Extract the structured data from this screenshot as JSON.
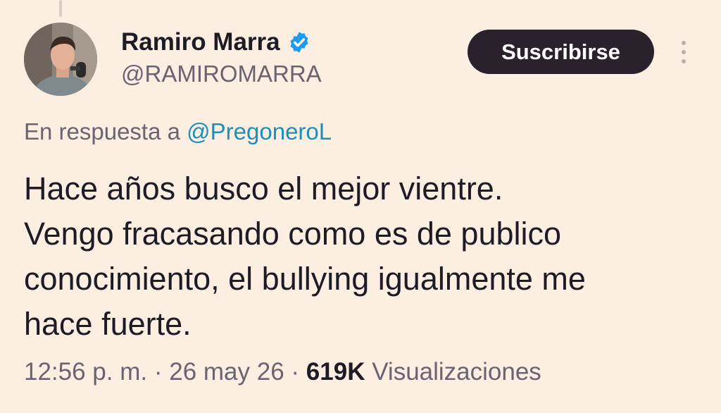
{
  "tweet": {
    "author": {
      "display_name": "Ramiro Marra",
      "handle": "@RAMIROMARRA",
      "verified": true,
      "verified_icon": "verified-badge-icon"
    },
    "subscribe_label": "Suscribirse",
    "more_icon": "more-vertical-icon",
    "reply_prefix": "En respuesta a",
    "reply_to": "@PregoneroL",
    "text_lines": [
      "Hace años busco el mejor vientre.",
      "Vengo fracasando como es de publico",
      "conocimiento, el bullying igualmente me",
      "hace fuerte."
    ],
    "time": "12:56 p. m.",
    "separator": "·",
    "date": "26 may 26",
    "views_count": "619K",
    "views_label": "Visualizaciones"
  },
  "colors": {
    "background": "#fcefe2",
    "text": "#1f1b24",
    "muted": "#6b6470",
    "link": "#1d8fb8",
    "button": "#2a212c",
    "verified": "#1d9bf0"
  }
}
